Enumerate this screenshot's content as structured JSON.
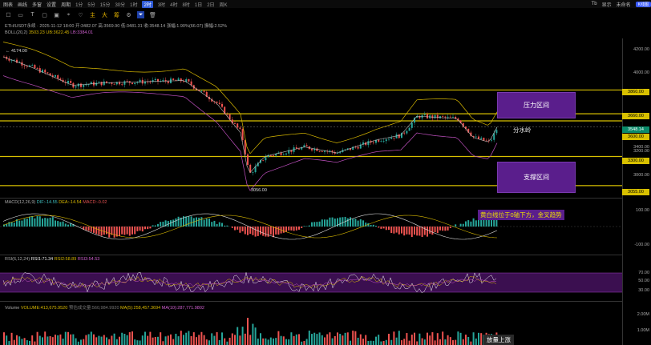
{
  "topbar": {
    "items": [
      "图表",
      "画线",
      "多窗",
      "设置"
    ],
    "period_menu": "周期",
    "timeframes": [
      {
        "label": "1分",
        "active": false
      },
      {
        "label": "5分",
        "active": false
      },
      {
        "label": "15分",
        "active": false
      },
      {
        "label": "30分",
        "active": false
      },
      {
        "label": "1时",
        "active": false
      },
      {
        "label": "2时",
        "active": true
      },
      {
        "label": "3时",
        "active": false
      },
      {
        "label": "4时",
        "active": false
      },
      {
        "label": "8时",
        "active": false
      },
      {
        "label": "1日",
        "active": false
      },
      {
        "label": "2日",
        "active": false
      },
      {
        "label": "周K",
        "active": false
      }
    ],
    "right_items": [
      "Tb",
      "显示",
      "未命名"
    ],
    "right_badge": "K线图"
  },
  "toolbar2": {
    "tools": [
      "checkbox-icon",
      "rectangle-icon",
      "text-icon",
      "square-icon",
      "image-icon",
      "pin-icon",
      "heart-icon"
    ],
    "yellow_tools": [
      "主",
      "大",
      "筹"
    ],
    "more_tools": [
      "gear-icon",
      "filter-icon",
      "trash-icon"
    ]
  },
  "main_legend": {
    "symbol": "ETH/USDT永续 · 2025-11-12 18:00",
    "open": "开:3482.07",
    "high": "高:3569.90",
    "low": "低:3481.31",
    "close": "收:3548.14",
    "change": "涨幅:1.90%(66.07)",
    "amplitude": "振幅:2.52%",
    "boll_name": "BOLL(20,2)",
    "boll_mid": "3503.23",
    "boll_ub": "UB:3622.45",
    "boll_lb": "LB:3384.01"
  },
  "price_axis": [
    "4200.00",
    "4000.00",
    "3800.00",
    "3600.00",
    "3400.00",
    "3200.00",
    "3000.00"
  ],
  "levels": [
    {
      "label": "3860.00",
      "value": 3860
    },
    {
      "label": "3660.00",
      "value": 3660
    },
    {
      "label": "3600.00",
      "value": 3600
    },
    {
      "label": "3300.00",
      "value": 3300
    },
    {
      "label": "3055.00",
      "value": 3055
    }
  ],
  "current_price": "3548.14",
  "annotations": {
    "high_marker": "← 4174.00",
    "low_marker": "3056.00",
    "resistance_zone": "压力区间",
    "support_zone": "支撑区间",
    "watershed": "分水岭",
    "macd_note": "黄白线位于0轴下方，金叉趋势",
    "volume_note": "放量上涨"
  },
  "macd_legend": {
    "name": "MACD(12,26,9)",
    "dif": "DIF:-14.55",
    "dea": "DEA:-14.54",
    "macd": "MACD:-0.02"
  },
  "macd_axis": [
    "100.00",
    "-100.00"
  ],
  "rsi_legend": {
    "name": "RSI(6,12,24)",
    "rsi1": "RSI1:71.34",
    "rsi2": "RSI2:58.89",
    "rsi3": "RSI3:54.53"
  },
  "rsi_axis": [
    "70.00",
    "50.00",
    "30.00"
  ],
  "volume_legend": {
    "name": "Volume",
    "volume": "VOLUME:413,675.9520",
    "pred": "预估成交量:560,984.9920",
    "ma5": "MA(5):258,457.3694",
    "ma10": "MA(10):287,771.9802"
  },
  "volume_axis": [
    "2.00M",
    "1.00M"
  ],
  "colors": {
    "up": "#26a69a",
    "down": "#ef5350",
    "level_line": "#d8c000",
    "zone": "#5a1e8c",
    "boll_upper": "#d8b800",
    "boll_lower": "#c050c0"
  }
}
